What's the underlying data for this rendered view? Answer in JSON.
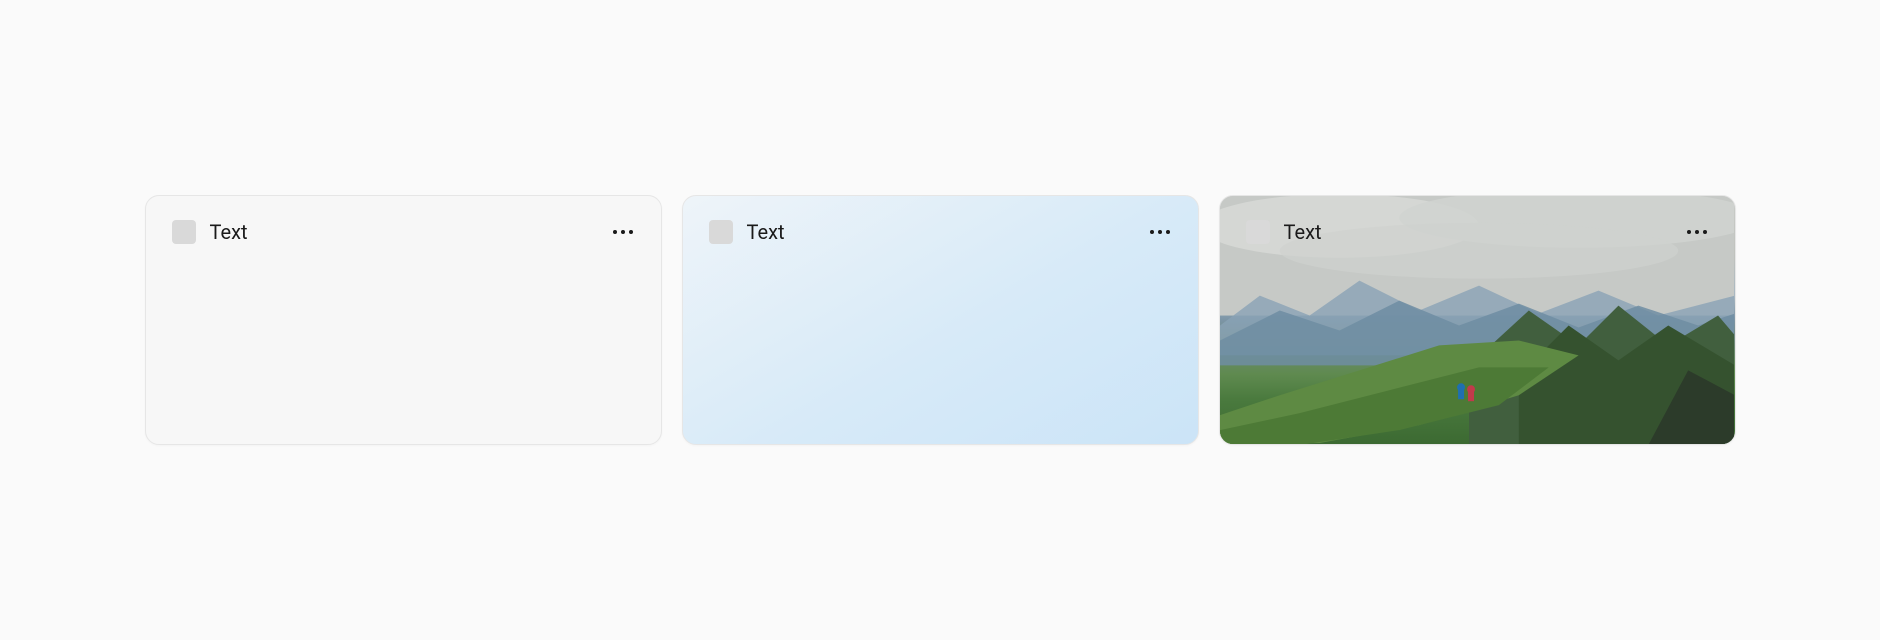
{
  "cards": [
    {
      "title": "Text",
      "variant": "plain"
    },
    {
      "title": "Text",
      "variant": "gradient"
    },
    {
      "title": "Text",
      "variant": "image"
    }
  ],
  "icons": {
    "placeholder": "placeholder-icon",
    "overflow": "more-horizontal-icon"
  }
}
